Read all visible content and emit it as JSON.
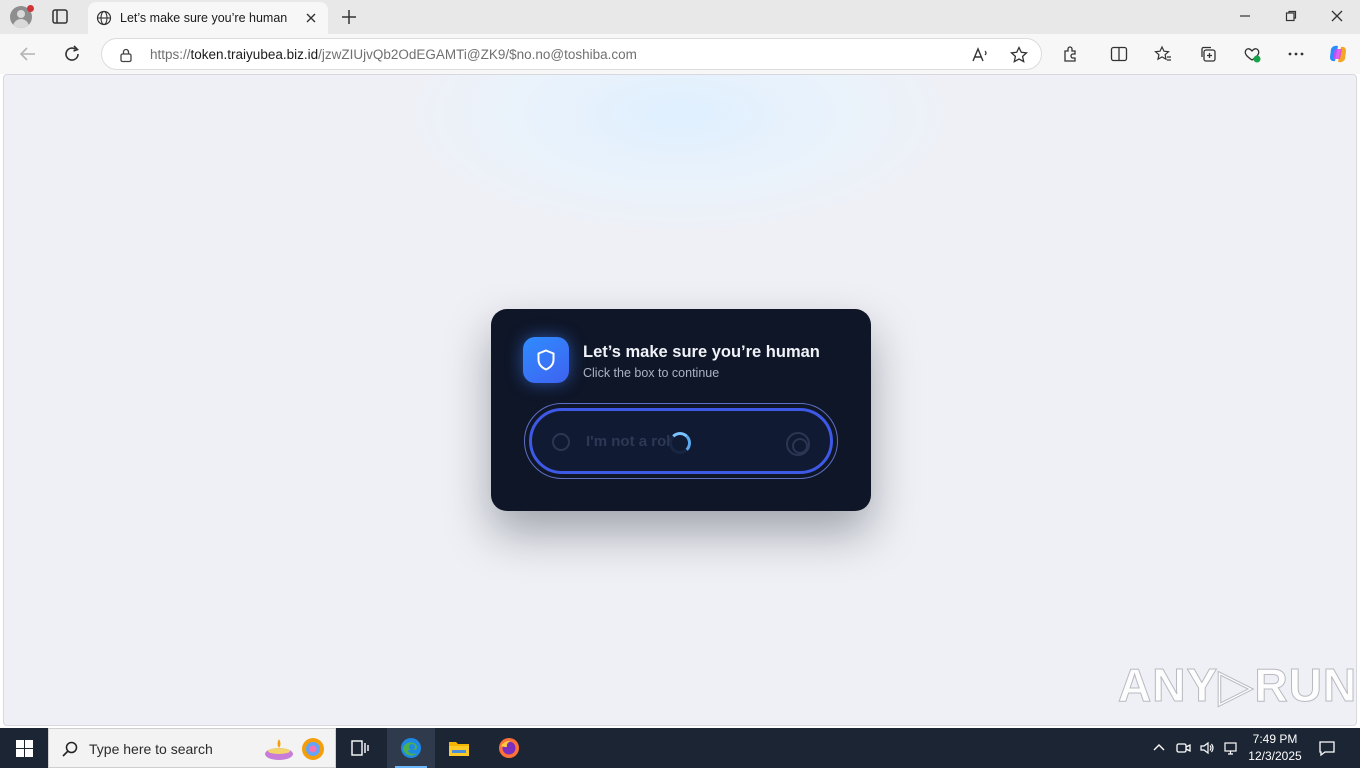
{
  "browser": {
    "tab": {
      "title": "Let’s make sure you’re human"
    },
    "address": {
      "prefix": "https://",
      "host": "token.traiyubea.biz.id",
      "path": "/jzwZIUjvQb2OdEGAMTi@ZK9/$no.no@toshiba.com"
    }
  },
  "page": {
    "card": {
      "title": "Let’s make sure you’re human",
      "subtitle": "Click the box to continue",
      "checkbox_label": "I'm not a robot"
    },
    "watermark": "ANY▷RUN"
  },
  "taskbar": {
    "search_placeholder": "Type here to search",
    "time": "7:49 PM",
    "date": "12/3/2025"
  },
  "colors": {
    "card_bg": "#0f1628",
    "accent_blue": "#3d59e6",
    "shield_gradient_start": "#2f8cff",
    "taskbar_bg": "#1c2533"
  }
}
